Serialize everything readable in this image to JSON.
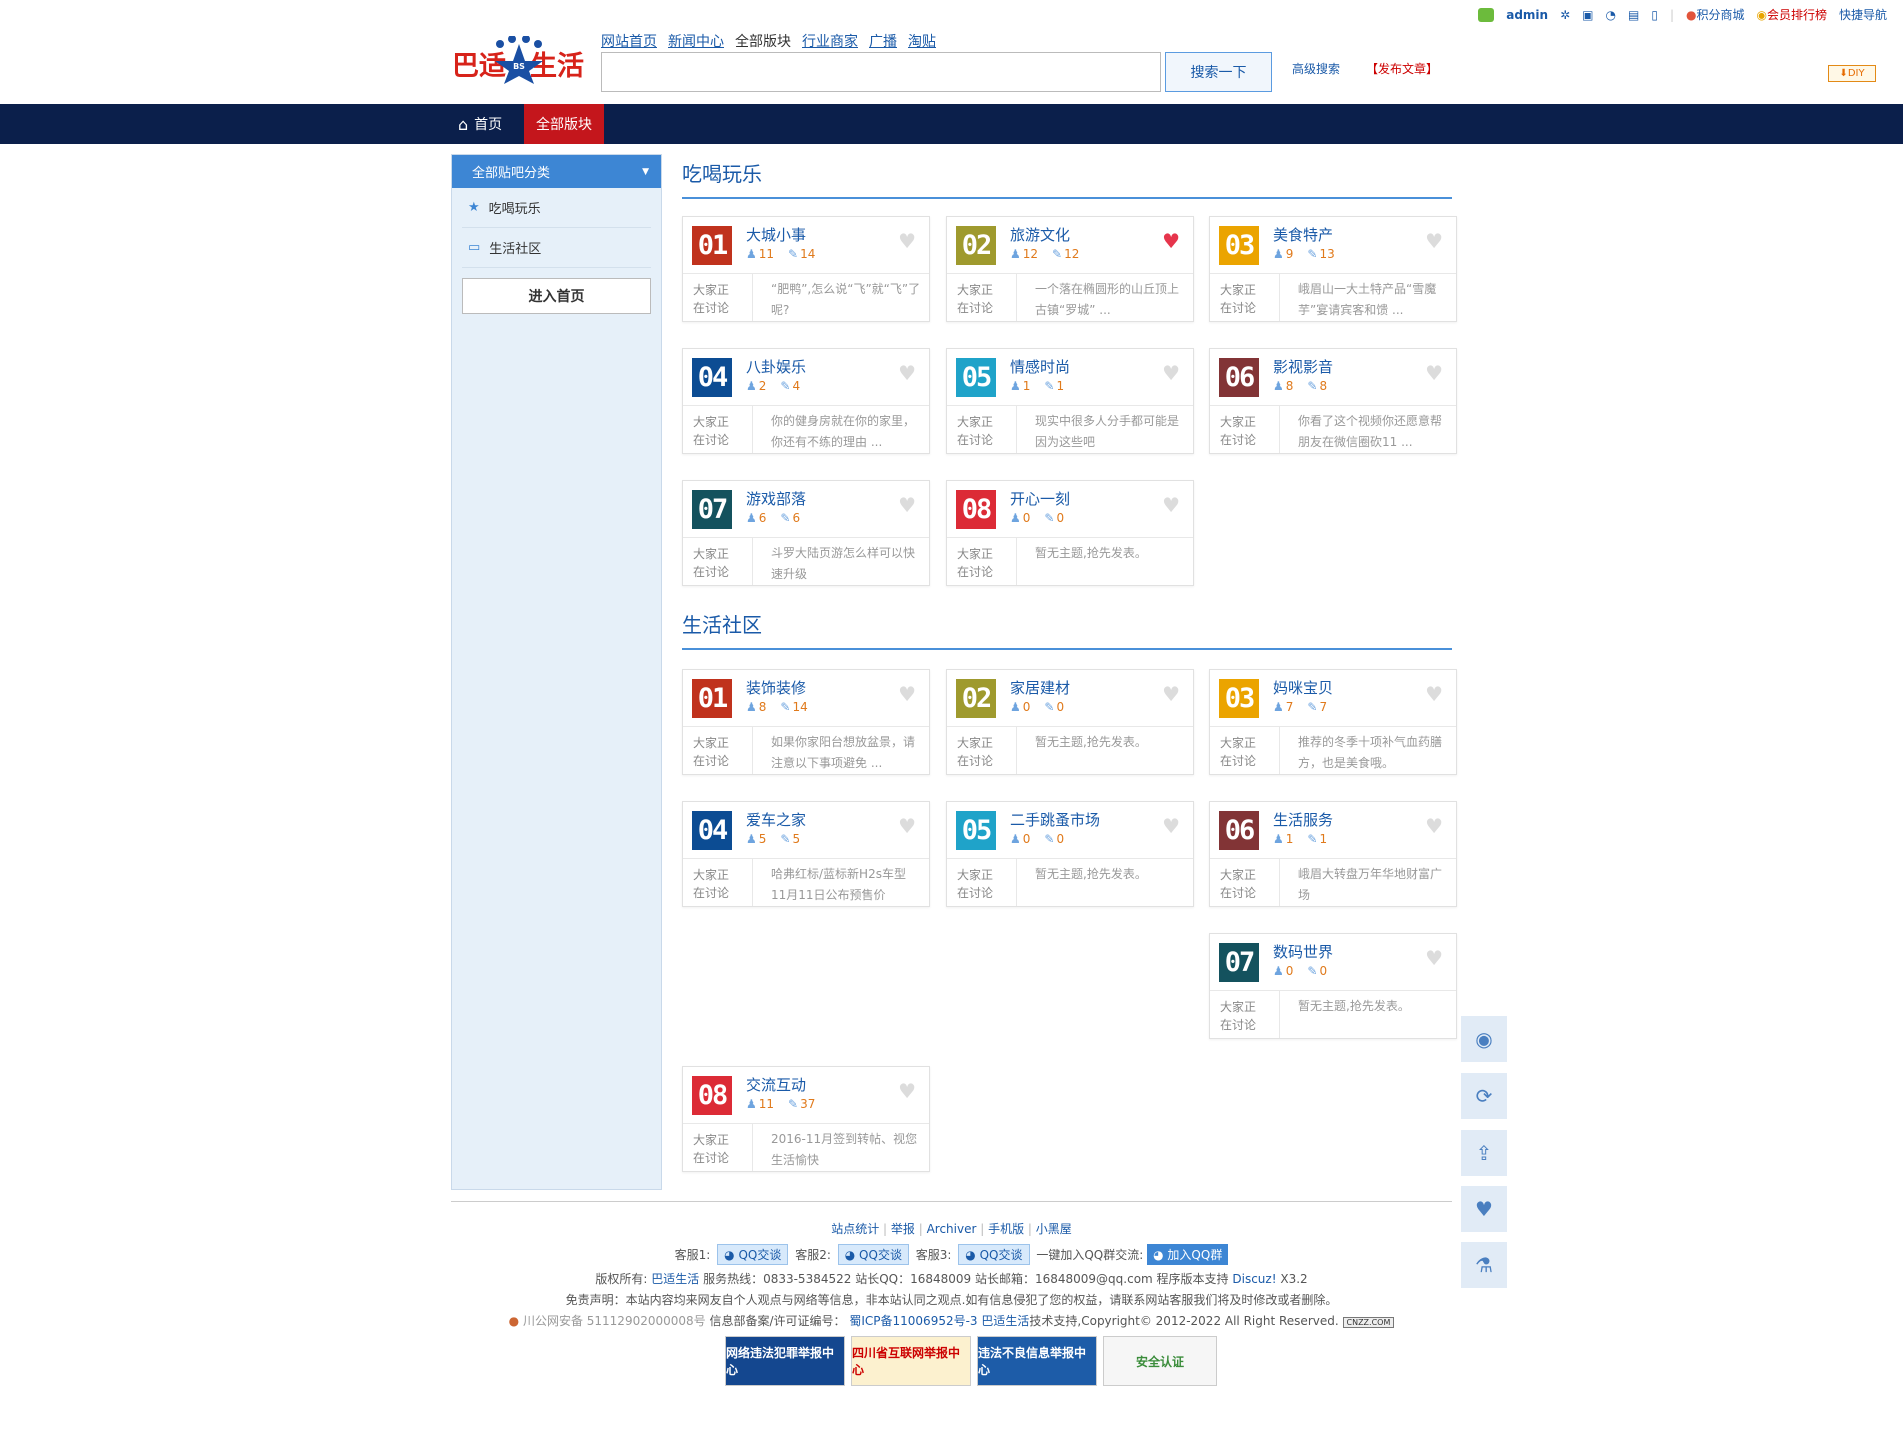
{
  "topbar": {
    "user": "admin",
    "shop": "积分商城",
    "rank": "会员排行榜",
    "quicknav": "快捷导航"
  },
  "logo": {
    "text": "巴适生活",
    "badge": "BS"
  },
  "quick_nav": {
    "items": [
      "网站首页",
      "新闻中心",
      "全部版块",
      "行业商家",
      "广播",
      "淘贴"
    ],
    "current_index": 2
  },
  "search": {
    "placeholder": "",
    "button": "搜索一下",
    "advanced": "高级搜索",
    "post": "【发布文章】",
    "diy": "DIY"
  },
  "navbar": {
    "home": "首页",
    "all": "全部版块"
  },
  "sidebar": {
    "title": "全部贴吧分类",
    "items": [
      "吃喝玩乐",
      "生活社区"
    ],
    "enter": "进入首页"
  },
  "discuss_label": [
    "大家正",
    "在讨论"
  ],
  "sections": [
    {
      "title": "吃喝玩乐",
      "forums": [
        {
          "num": "01",
          "name": "大城小事",
          "members": "11",
          "posts": "14",
          "desc": "“肥鸭”,怎么说“飞”就“飞”了呢?",
          "fav": false
        },
        {
          "num": "02",
          "name": "旅游文化",
          "members": "12",
          "posts": "12",
          "desc": "一个落在椭圆形的山丘顶上古镇“罗城” ...",
          "fav": true
        },
        {
          "num": "03",
          "name": "美食特产",
          "members": "9",
          "posts": "13",
          "desc": "峨眉山一大土特产品“雪魔芋”宴请宾客和馈 ...",
          "fav": false
        },
        {
          "num": "04",
          "name": "八卦娱乐",
          "members": "2",
          "posts": "4",
          "desc": "你的健身房就在你的家里，你还有不练的理由 ...",
          "fav": false
        },
        {
          "num": "05",
          "name": "情感时尚",
          "members": "1",
          "posts": "1",
          "desc": "现实中很多人分手都可能是因为这些吧",
          "fav": false
        },
        {
          "num": "06",
          "name": "影视影音",
          "members": "8",
          "posts": "8",
          "desc": "你看了这个视频你还愿意帮朋友在微信圈砍11 ...",
          "fav": false
        },
        {
          "num": "07",
          "name": "游戏部落",
          "members": "6",
          "posts": "6",
          "desc": "斗罗大陆页游怎么样可以快速升级",
          "fav": false
        },
        {
          "num": "08",
          "name": "开心一刻",
          "members": "0",
          "posts": "0",
          "desc": "暂无主题,抢先发表。",
          "fav": false
        }
      ]
    },
    {
      "title": "生活社区",
      "forums": [
        {
          "num": "01",
          "name": "装饰装修",
          "members": "8",
          "posts": "14",
          "desc": "如果你家阳台想放盆景，请注意以下事项避免 ...",
          "fav": false
        },
        {
          "num": "02",
          "name": "家居建材",
          "members": "0",
          "posts": "0",
          "desc": "暂无主题,抢先发表。",
          "fav": false
        },
        {
          "num": "03",
          "name": "妈咪宝贝",
          "members": "7",
          "posts": "7",
          "desc": "推荐的冬季十项补气血药膳方，也是美食哦。",
          "fav": false
        },
        {
          "num": "04",
          "name": "爱车之家",
          "members": "5",
          "posts": "5",
          "desc": "哈弗红标/蓝标新H2s车型11月11日公布预售价",
          "fav": false
        },
        {
          "num": "05",
          "name": "二手跳蚤市场",
          "members": "0",
          "posts": "0",
          "desc": "暂无主题,抢先发表。",
          "fav": false
        },
        {
          "num": "06",
          "name": "生活服务",
          "members": "1",
          "posts": "1",
          "desc": "峨眉大转盘万年华地财富广场",
          "fav": false
        },
        {
          "num": "07",
          "name": "数码世界",
          "members": "0",
          "posts": "0",
          "desc": "暂无主题,抢先发表。",
          "fav": false
        },
        {
          "num": "08",
          "name": "交流互动",
          "members": "11",
          "posts": "37",
          "desc": "2016-11月签到转帖、视您生活愉快",
          "fav": false
        }
      ]
    }
  ],
  "num_colors": [
    "#c0321d",
    "#9f9a2e",
    "#eba400",
    "#0c4c93",
    "#1fa3c9",
    "#823436",
    "#14525e",
    "#dc2b36"
  ],
  "footer": {
    "links": [
      "站点统计",
      "举报",
      "Archiver",
      "手机版",
      "小黑屋"
    ],
    "service1": "客服1:",
    "service2": "客服2:",
    "service3": "客服3:",
    "qq_btn": "QQ交谈",
    "group_label": "一键加入QQ群交流:",
    "group_btn": "加入QQ群",
    "copyright_prefix": "版权所有:",
    "site_name": "巴适生活",
    "hotline": "服务热线：0833-5384522  站长QQ：16848009  站长邮箱：16848009@qq.com  程序版本支持",
    "discuz": "Discuz!",
    "version": "X3.2",
    "disclaimer": "免责声明：本站内容均来网友自个人观点与网络等信息，非本站认同之观点.如有信息侵犯了您的权益，请联系网站客服我们将及时修改或者删除。",
    "police": "川公网安备 51112902000008号",
    "icp_label": "信息部备案/许可证编号：",
    "icp": "蜀ICP备11006952号-3",
    "tech": "巴适生活",
    "tech_suffix": "技术支持,Copyright© 2012-2022 All Right Reserved.",
    "cnzz": "CNZZ.COM",
    "badges": [
      "网络违法犯罪举报中心",
      "四川省互联网举报中心",
      "违法不良信息举报中心",
      "安全认证"
    ]
  },
  "icons": {
    "home": "home-icon",
    "star": "star-icon",
    "tv": "tv-icon",
    "heart": "heart-icon",
    "user": "user-icon",
    "edit": "edit-icon"
  }
}
